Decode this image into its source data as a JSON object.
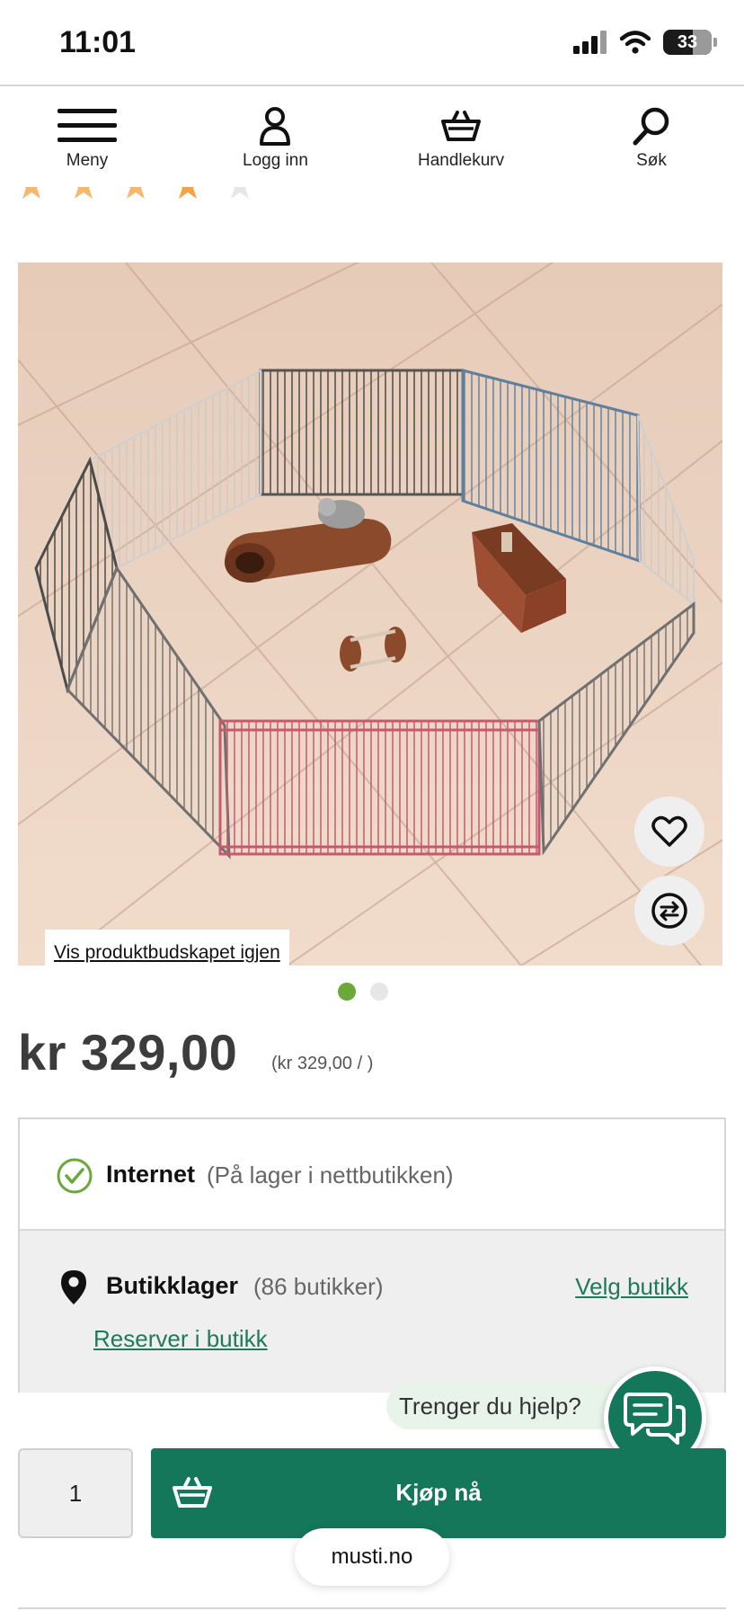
{
  "status_bar": {
    "time": "11:01",
    "battery": "33"
  },
  "nav": {
    "menu": "Meny",
    "login": "Logg inn",
    "cart": "Handlekurv",
    "search": "Søk"
  },
  "product": {
    "image_alt": "Hamster playpen with wooden log, house and toy on a wooden floor",
    "show_message_link": "Vis produktbudskapet igjen",
    "carousel": {
      "current": 1,
      "total": 2
    },
    "price": "kr 329,00",
    "unit_price": "(kr 329,00 / )"
  },
  "stock": {
    "online_title": "Internet",
    "online_note": "(På lager i nettbutikken)",
    "stores_title": "Butikklager",
    "stores_note": "(86 butikker)",
    "choose_store": "Velg butikk",
    "reserve": "Reserver i butikk"
  },
  "help": {
    "bubble": "Trenger du hjelp?"
  },
  "buy": {
    "quantity": "1",
    "button": "Kjøp nå"
  },
  "browser": {
    "url": "musti.no"
  },
  "colors": {
    "brand_green": "#14775a",
    "dot_active": "#6aa83a",
    "link": "#1f7a5a"
  }
}
